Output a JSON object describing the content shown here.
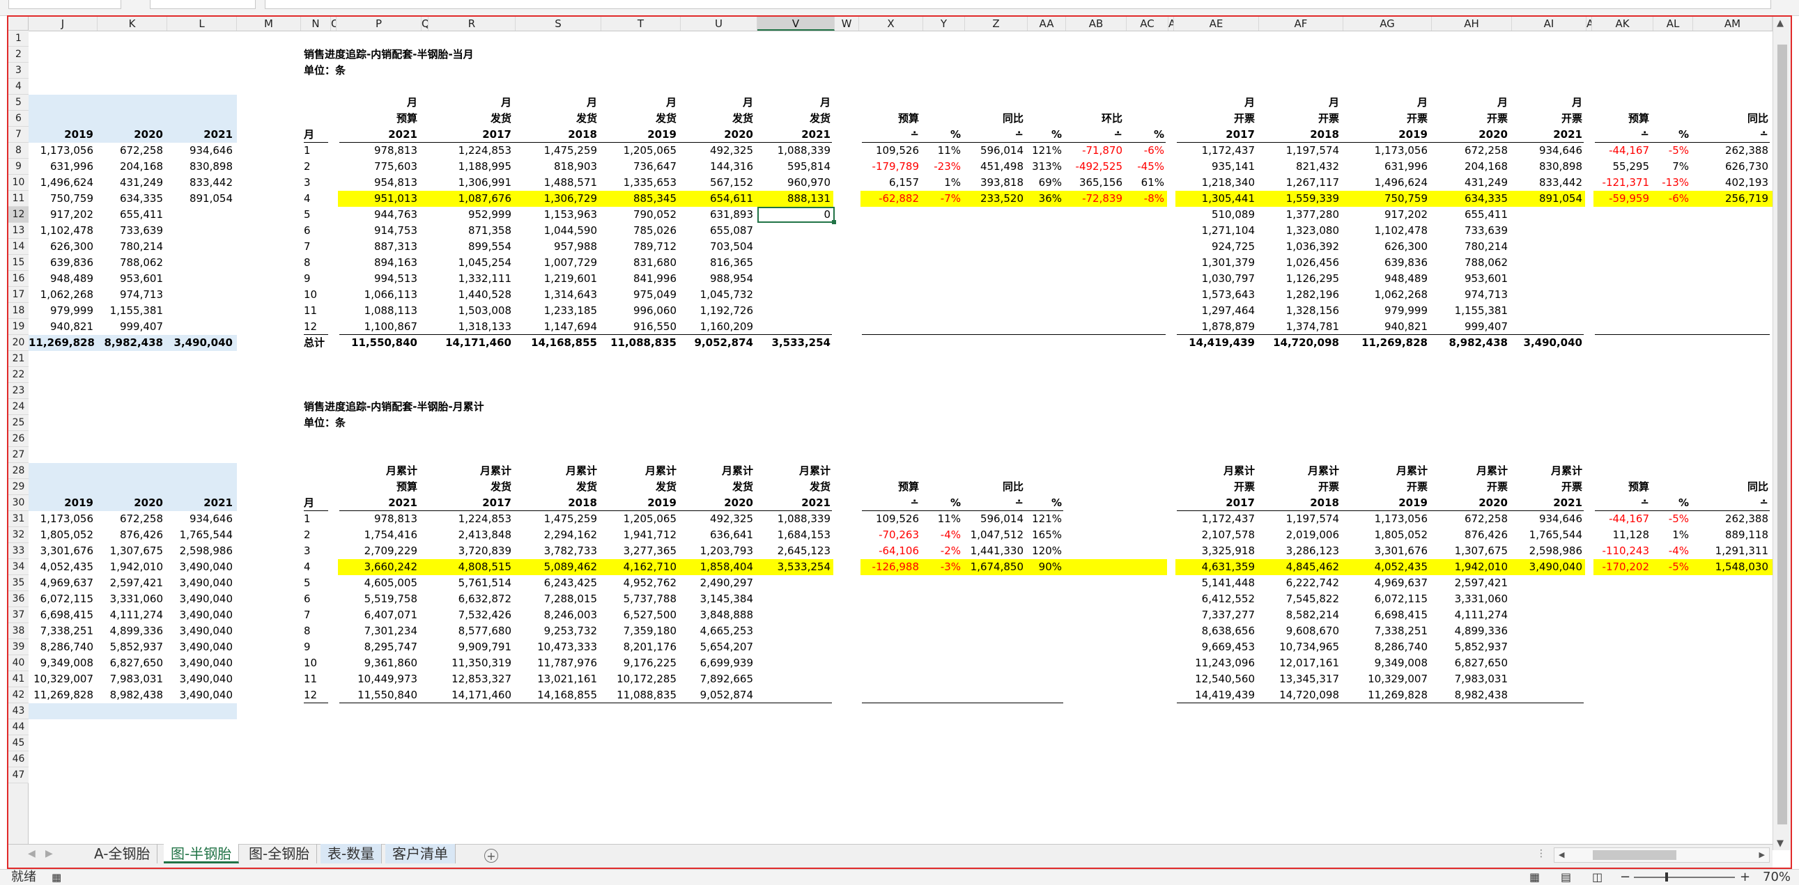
{
  "status": {
    "ready": "就绪",
    "zoom": "70%"
  },
  "icons": {
    "macro": "macro-record-icon",
    "normal": "normal-view-icon",
    "layout": "page-layout-view-icon",
    "pagebreak": "page-break-view-icon",
    "add": "add-sheet-icon"
  },
  "sheets": [
    {
      "label": "A-全钢胎"
    },
    {
      "label": "图-半钢胎"
    },
    {
      "label": "图-全钢胎"
    },
    {
      "label": "表-数量"
    },
    {
      "label": "客户清单"
    }
  ],
  "active_sheet": "图-半钢胎",
  "col_letters": {
    "J": "J",
    "K": "K",
    "L": "L",
    "M": "M",
    "N": "N",
    "O": "O",
    "P": "P",
    "Q": "Q",
    "R": "R",
    "S": "S",
    "T": "T",
    "U": "U",
    "V": "V",
    "W": "W",
    "X": "X",
    "Y": "Y",
    "Z": "Z",
    "AA": "AA",
    "AB": "AB",
    "AC": "AC",
    "AD": "AD",
    "AE": "AE",
    "AF": "AF",
    "AG": "AG",
    "AH": "AH",
    "AI": "AI",
    "AJ": "AJ",
    "AK": "AK",
    "AL": "AL",
    "AM": "AM"
  },
  "row_numbers": [
    "1",
    "2",
    "3",
    "4",
    "5",
    "6",
    "7",
    "8",
    "9",
    "10",
    "11",
    "12",
    "13",
    "14",
    "15",
    "16",
    "17",
    "18",
    "19",
    "20",
    "21",
    "22",
    "23",
    "24",
    "25",
    "26",
    "27",
    "28",
    "29",
    "30",
    "31",
    "32",
    "33",
    "34",
    "35",
    "36",
    "37",
    "38",
    "39",
    "40",
    "41",
    "42",
    "43",
    "44",
    "45",
    "46",
    "47"
  ],
  "titles": {
    "t1": "销售进度追踪-内销配套-半钢胎-当月",
    "u1": "单位：条",
    "t2": "销售进度追踪-内销配套-半钢胎-月累计",
    "u2": "单位：条"
  },
  "cells": {
    "JKL": {
      "years": [
        "2019",
        "2020",
        "2021"
      ],
      "top": [
        [
          "1,173,056",
          "672,258",
          "934,646"
        ],
        [
          "631,996",
          "204,168",
          "830,898"
        ],
        [
          "1,496,624",
          "431,249",
          "833,442"
        ],
        [
          "750,759",
          "634,335",
          "891,054"
        ],
        [
          "917,202",
          "655,411",
          ""
        ],
        [
          "1,102,478",
          "733,639",
          ""
        ],
        [
          "626,300",
          "780,214",
          ""
        ],
        [
          "639,836",
          "788,062",
          ""
        ],
        [
          "948,489",
          "953,601",
          ""
        ],
        [
          "1,062,268",
          "974,713",
          ""
        ],
        [
          "979,999",
          "1,155,381",
          ""
        ],
        [
          "940,821",
          "999,407",
          ""
        ]
      ],
      "top_total": [
        "11,269,828",
        "8,982,438",
        "3,490,040"
      ],
      "bottom": [
        [
          "1,173,056",
          "672,258",
          "934,646"
        ],
        [
          "1,805,052",
          "876,426",
          "1,765,544"
        ],
        [
          "3,301,676",
          "1,307,675",
          "2,598,986"
        ],
        [
          "4,052,435",
          "1,942,010",
          "3,490,040"
        ],
        [
          "4,969,637",
          "2,597,421",
          "3,490,040"
        ],
        [
          "6,072,115",
          "3,331,060",
          "3,490,040"
        ],
        [
          "6,698,415",
          "4,111,274",
          "3,490,040"
        ],
        [
          "7,338,251",
          "4,899,336",
          "3,490,040"
        ],
        [
          "8,286,740",
          "5,852,937",
          "3,490,040"
        ],
        [
          "9,349,008",
          "6,827,650",
          "3,490,040"
        ],
        [
          "10,329,007",
          "7,983,031",
          "3,490,040"
        ],
        [
          "11,269,828",
          "8,982,438",
          "3,490,040"
        ]
      ]
    },
    "main_top": {
      "h5": [
        "月",
        "月",
        "月",
        "月",
        "月",
        "月"
      ],
      "h6": [
        "预算",
        "发货",
        "发货",
        "发货",
        "发货",
        "发货"
      ],
      "h7": [
        "2021",
        "2017",
        "2018",
        "2019",
        "2020",
        "2021"
      ],
      "month_hdr": "月",
      "rows": [
        [
          "1",
          "978,813",
          "1,224,853",
          "1,475,259",
          "1,205,065",
          "492,325",
          "1,088,339"
        ],
        [
          "2",
          "775,603",
          "1,188,995",
          "818,903",
          "736,647",
          "144,316",
          "595,814"
        ],
        [
          "3",
          "954,813",
          "1,306,991",
          "1,488,571",
          "1,335,653",
          "567,152",
          "960,970"
        ],
        [
          "4",
          "951,013",
          "1,087,676",
          "1,306,729",
          "885,345",
          "654,611",
          "888,131"
        ],
        [
          "5",
          "944,763",
          "952,999",
          "1,153,963",
          "790,052",
          "631,893",
          "0"
        ],
        [
          "6",
          "914,753",
          "871,358",
          "1,044,590",
          "785,026",
          "655,087",
          ""
        ],
        [
          "7",
          "887,313",
          "899,554",
          "957,988",
          "789,712",
          "703,504",
          ""
        ],
        [
          "8",
          "894,163",
          "1,045,254",
          "1,007,729",
          "831,680",
          "816,365",
          ""
        ],
        [
          "9",
          "994,513",
          "1,332,111",
          "1,219,601",
          "841,996",
          "988,954",
          ""
        ],
        [
          "10",
          "1,066,113",
          "1,440,528",
          "1,314,643",
          "975,049",
          "1,045,732",
          ""
        ],
        [
          "11",
          "1,088,113",
          "1,503,008",
          "1,233,185",
          "996,060",
          "1,192,726",
          ""
        ],
        [
          "12",
          "1,100,867",
          "1,318,133",
          "1,147,694",
          "916,550",
          "1,160,209",
          ""
        ]
      ],
      "total": [
        "总计",
        "11,550,840",
        "14,171,460",
        "14,168,855",
        "11,088,835",
        "9,052,874",
        "3,533,254"
      ]
    },
    "cmp_top": {
      "h6": [
        "预算",
        "同比",
        "环比"
      ],
      "h7": [
        "∸",
        "%",
        "∸",
        "%",
        "∸",
        "%"
      ],
      "rows": [
        [
          "109,526",
          "11%",
          "596,014",
          "121%",
          "-71,870",
          "-6%"
        ],
        [
          "-179,789",
          "-23%",
          "451,498",
          "313%",
          "-492,525",
          "-45%"
        ],
        [
          "6,157",
          "1%",
          "393,818",
          "69%",
          "365,156",
          "61%"
        ],
        [
          "-62,882",
          "-7%",
          "233,520",
          "36%",
          "-72,839",
          "-8%"
        ]
      ]
    },
    "inv_top": {
      "h5": [
        "月",
        "月",
        "月",
        "月",
        "月"
      ],
      "h6": [
        "开票",
        "开票",
        "开票",
        "开票",
        "开票"
      ],
      "h7": [
        "2017",
        "2018",
        "2019",
        "2020",
        "2021"
      ],
      "rows": [
        [
          "1,172,437",
          "1,197,574",
          "1,173,056",
          "672,258",
          "934,646"
        ],
        [
          "935,141",
          "821,432",
          "631,996",
          "204,168",
          "830,898"
        ],
        [
          "1,218,340",
          "1,267,117",
          "1,496,624",
          "431,249",
          "833,442"
        ],
        [
          "1,305,441",
          "1,559,339",
          "750,759",
          "634,335",
          "891,054"
        ],
        [
          "510,089",
          "1,377,280",
          "917,202",
          "655,411",
          ""
        ],
        [
          "1,271,104",
          "1,323,080",
          "1,102,478",
          "733,639",
          ""
        ],
        [
          "924,725",
          "1,036,392",
          "626,300",
          "780,214",
          ""
        ],
        [
          "1,301,379",
          "1,026,456",
          "639,836",
          "788,062",
          ""
        ],
        [
          "1,030,797",
          "1,126,295",
          "948,489",
          "953,601",
          ""
        ],
        [
          "1,573,643",
          "1,282,196",
          "1,062,268",
          "974,713",
          ""
        ],
        [
          "1,297,464",
          "1,328,156",
          "979,999",
          "1,155,381",
          ""
        ],
        [
          "1,878,879",
          "1,374,781",
          "940,821",
          "999,407",
          ""
        ]
      ],
      "total": [
        "14,419,439",
        "14,720,098",
        "11,269,828",
        "8,982,438",
        "3,490,040"
      ]
    },
    "inv_cmp_top": {
      "h6": [
        "预算",
        "同比"
      ],
      "h7": [
        "∸",
        "%",
        "∸"
      ],
      "rows": [
        [
          "-44,167",
          "-5%",
          "262,388"
        ],
        [
          "55,295",
          "7%",
          "626,730"
        ],
        [
          "-121,371",
          "-13%",
          "402,193"
        ],
        [
          "-59,959",
          "-6%",
          "256,719"
        ]
      ]
    },
    "main_bottom": {
      "h28": [
        "月累计",
        "月累计",
        "月累计",
        "月累计",
        "月累计",
        "月累计"
      ],
      "h29": [
        "预算",
        "发货",
        "发货",
        "发货",
        "发货",
        "发货"
      ],
      "h30": [
        "2021",
        "2017",
        "2018",
        "2019",
        "2020",
        "2021"
      ],
      "month_hdr": "月",
      "rows": [
        [
          "1",
          "978,813",
          "1,224,853",
          "1,475,259",
          "1,205,065",
          "492,325",
          "1,088,339"
        ],
        [
          "2",
          "1,754,416",
          "2,413,848",
          "2,294,162",
          "1,941,712",
          "636,641",
          "1,684,153"
        ],
        [
          "3",
          "2,709,229",
          "3,720,839",
          "3,782,733",
          "3,277,365",
          "1,203,793",
          "2,645,123"
        ],
        [
          "4",
          "3,660,242",
          "4,808,515",
          "5,089,462",
          "4,162,710",
          "1,858,404",
          "3,533,254"
        ],
        [
          "5",
          "4,605,005",
          "5,761,514",
          "6,243,425",
          "4,952,762",
          "2,490,297",
          ""
        ],
        [
          "6",
          "5,519,758",
          "6,632,872",
          "7,288,015",
          "5,737,788",
          "3,145,384",
          ""
        ],
        [
          "7",
          "6,407,071",
          "7,532,426",
          "8,246,003",
          "6,527,500",
          "3,848,888",
          ""
        ],
        [
          "8",
          "7,301,234",
          "8,577,680",
          "9,253,732",
          "7,359,180",
          "4,665,253",
          ""
        ],
        [
          "9",
          "8,295,747",
          "9,909,791",
          "10,473,333",
          "8,201,176",
          "5,654,207",
          ""
        ],
        [
          "10",
          "9,361,860",
          "11,350,319",
          "11,787,976",
          "9,176,225",
          "6,699,939",
          ""
        ],
        [
          "11",
          "10,449,973",
          "12,853,327",
          "13,021,161",
          "10,172,285",
          "7,892,665",
          ""
        ],
        [
          "12",
          "11,550,840",
          "14,171,460",
          "14,168,855",
          "11,088,835",
          "9,052,874",
          ""
        ]
      ]
    },
    "cmp_bottom": {
      "h29": [
        "预算",
        "同比"
      ],
      "h30": [
        "∸",
        "%",
        "∸",
        "%"
      ],
      "rows": [
        [
          "109,526",
          "11%",
          "596,014",
          "121%"
        ],
        [
          "-70,263",
          "-4%",
          "1,047,512",
          "165%"
        ],
        [
          "-64,106",
          "-2%",
          "1,441,330",
          "120%"
        ],
        [
          "-126,988",
          "-3%",
          "1,674,850",
          "90%"
        ]
      ]
    },
    "inv_bottom": {
      "h28": [
        "月累计",
        "月累计",
        "月累计",
        "月累计",
        "月累计"
      ],
      "h29": [
        "开票",
        "开票",
        "开票",
        "开票",
        "开票"
      ],
      "h30": [
        "2017",
        "2018",
        "2019",
        "2020",
        "2021"
      ],
      "rows": [
        [
          "1,172,437",
          "1,197,574",
          "1,173,056",
          "672,258",
          "934,646"
        ],
        [
          "2,107,578",
          "2,019,006",
          "1,805,052",
          "876,426",
          "1,765,544"
        ],
        [
          "3,325,918",
          "3,286,123",
          "3,301,676",
          "1,307,675",
          "2,598,986"
        ],
        [
          "4,631,359",
          "4,845,462",
          "4,052,435",
          "1,942,010",
          "3,490,040"
        ],
        [
          "5,141,448",
          "6,222,742",
          "4,969,637",
          "2,597,421",
          ""
        ],
        [
          "6,412,552",
          "7,545,822",
          "6,072,115",
          "3,331,060",
          ""
        ],
        [
          "7,337,277",
          "8,582,214",
          "6,698,415",
          "4,111,274",
          ""
        ],
        [
          "8,638,656",
          "9,608,670",
          "7,338,251",
          "4,899,336",
          ""
        ],
        [
          "9,669,453",
          "10,734,965",
          "8,286,740",
          "5,852,937",
          ""
        ],
        [
          "11,243,096",
          "12,017,161",
          "9,349,008",
          "6,827,650",
          ""
        ],
        [
          "12,540,560",
          "13,345,317",
          "10,329,007",
          "7,983,031",
          ""
        ],
        [
          "14,419,439",
          "14,720,098",
          "11,269,828",
          "8,982,438",
          ""
        ]
      ]
    },
    "inv_cmp_bottom": {
      "h29": [
        "预算",
        "同比"
      ],
      "h30": [
        "∸",
        "%",
        "∸"
      ],
      "rows": [
        [
          "-44,167",
          "-5%",
          "262,388"
        ],
        [
          "11,128",
          "1%",
          "889,118"
        ],
        [
          "-110,243",
          "-4%",
          "1,291,311"
        ],
        [
          "-170,202",
          "-5%",
          "1,548,030"
        ]
      ]
    }
  },
  "colors": {
    "highlight": "#ffff00",
    "header_fill": "#ddebf7",
    "negative": "#ff0000",
    "accent": "#217346",
    "frame": "#e12a2a"
  }
}
